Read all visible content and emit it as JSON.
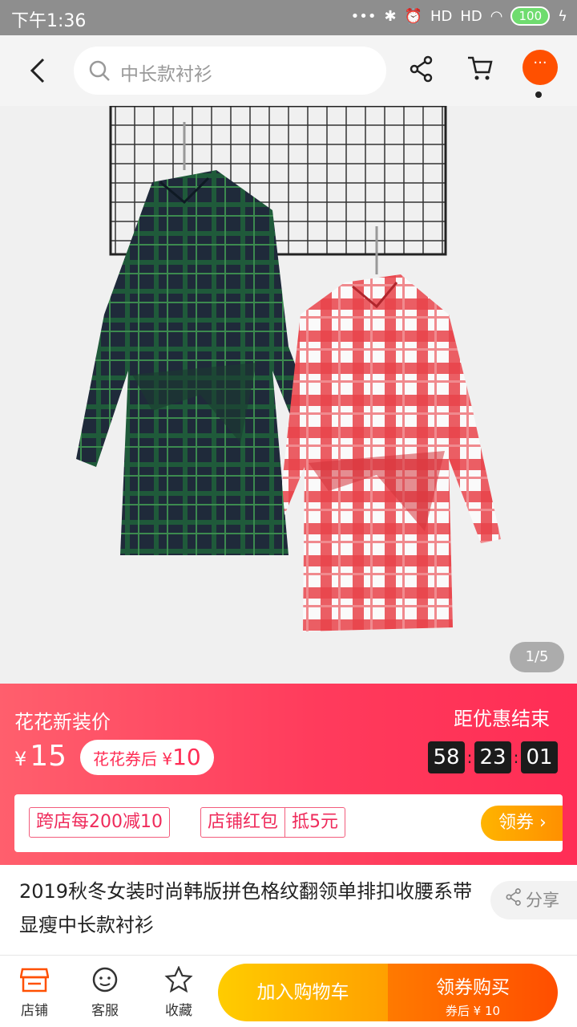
{
  "status_bar": {
    "time": "下午1:36",
    "network1": "HD",
    "network2": "HD",
    "battery": "100"
  },
  "nav": {
    "search_placeholder": "中长款衬衫"
  },
  "gallery": {
    "counter": "1/5"
  },
  "price": {
    "label": "花花新装价",
    "currency": "¥",
    "amount": "15",
    "coupon_prefix": "花花券后 ¥",
    "coupon_amount": "10",
    "countdown_label": "距优惠结束",
    "countdown": [
      "58",
      "23",
      "01"
    ]
  },
  "coupons": {
    "cross_store": "跨店每200减10",
    "store_packet": "店铺红包",
    "store_packet_value": "抵5元",
    "get_button": "领券"
  },
  "product": {
    "title": "2019秋冬女装时尚韩版拼色格纹翻领单排扣收腰系带显瘦中长款衬衫",
    "share": "分享"
  },
  "bottom_bar": {
    "shop": "店铺",
    "service": "客服",
    "favorite": "收藏",
    "add_to_cart": "加入购物车",
    "buy": "领券购买",
    "buy_sub": "券后 ¥ 10"
  },
  "colors": {
    "accent": "#ff5000",
    "banner": "#ff3b5c",
    "cart_button": "#ffb400",
    "buy_button": "#ff5a00"
  }
}
